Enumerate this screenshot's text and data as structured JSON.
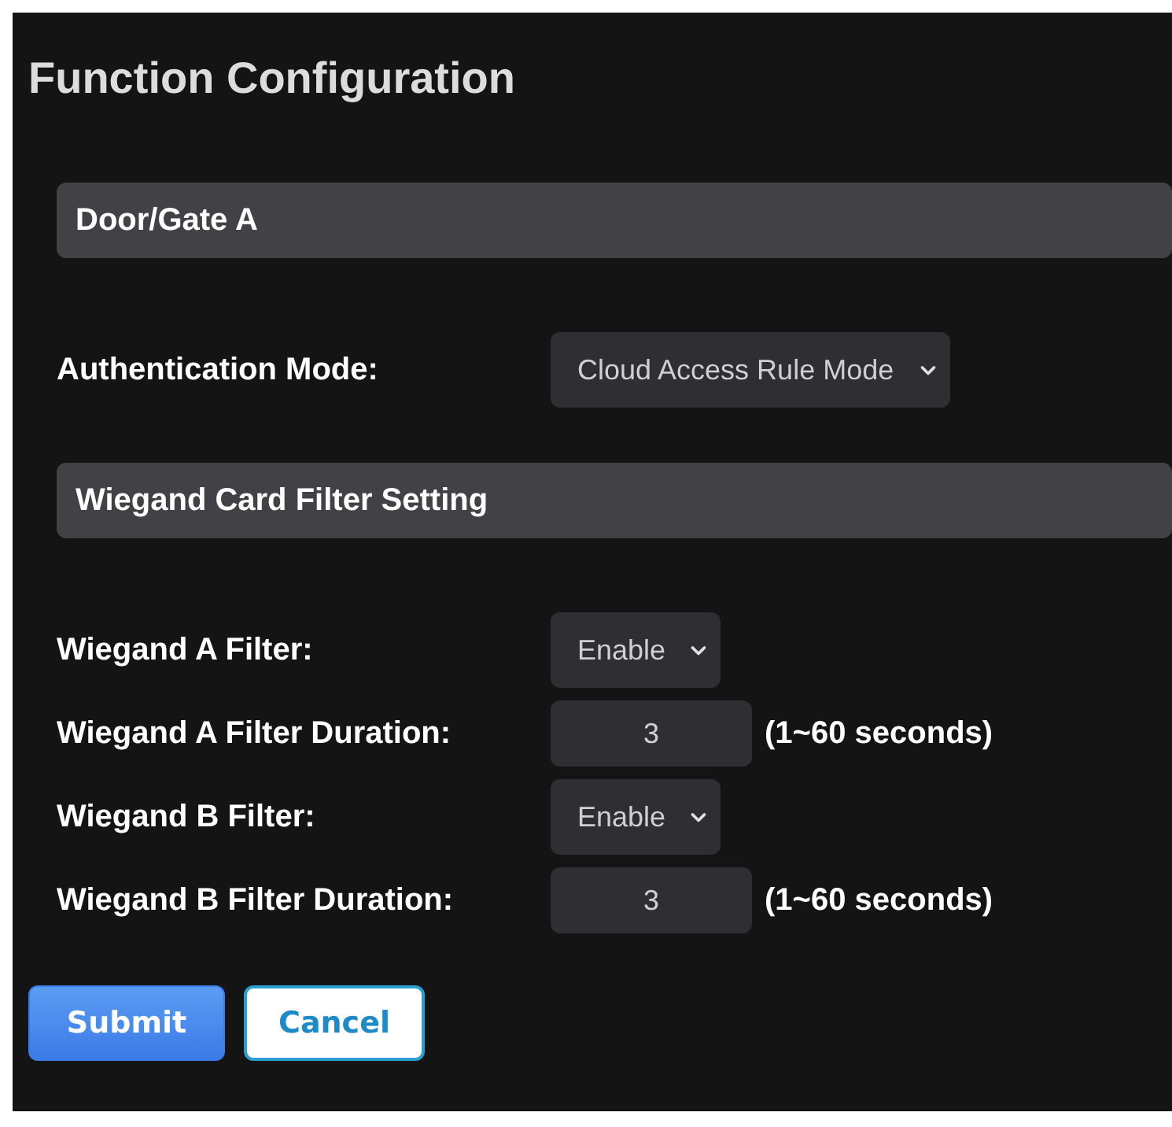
{
  "title": "Function Configuration",
  "sections": [
    {
      "heading": "Door/Gate A",
      "fields": [
        {
          "kind": "select",
          "label": "Authentication Mode:",
          "value": "Cloud Access Rule Mode"
        }
      ]
    },
    {
      "heading": "Wiegand Card Filter Setting",
      "fields": [
        {
          "kind": "select",
          "label": "Wiegand A Filter:",
          "value": "Enable"
        },
        {
          "kind": "number",
          "label": "Wiegand A Filter Duration:",
          "value": "3",
          "hint": "(1~60 seconds)"
        },
        {
          "kind": "select",
          "label": "Wiegand B Filter:",
          "value": "Enable"
        },
        {
          "kind": "number",
          "label": "Wiegand B Filter Duration:",
          "value": "3",
          "hint": "(1~60 seconds)"
        }
      ]
    }
  ],
  "buttons": [
    {
      "kind": "primary",
      "label": "Submit"
    },
    {
      "kind": "secondary",
      "label": "Cancel"
    }
  ]
}
